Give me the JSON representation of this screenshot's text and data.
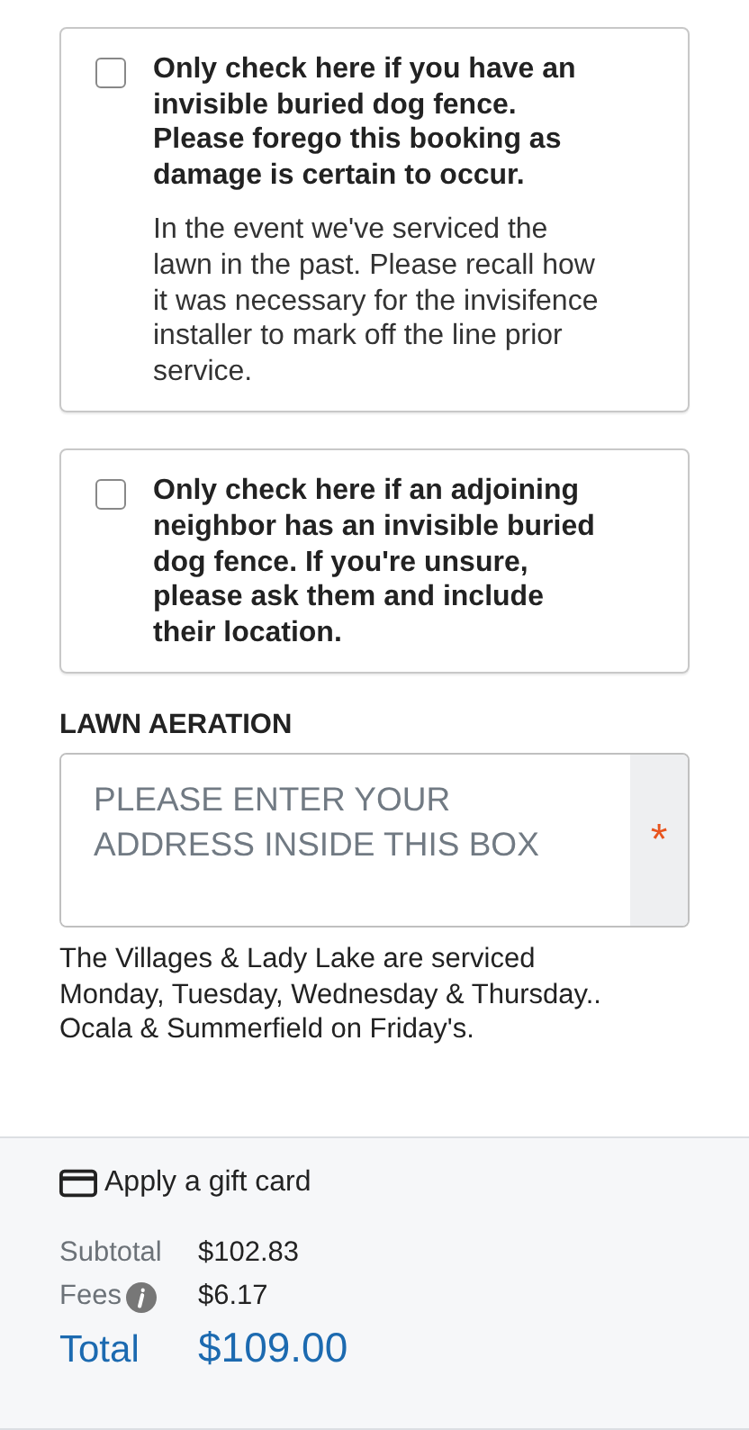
{
  "options": [
    {
      "checked": false,
      "label": "Only check here if you have an invisible buried dog fence. Please forego this booking as damage is certain to occur.",
      "note": "In the event we've serviced the lawn in the past. Please recall how it was necessary for the invisifence installer to mark off the line prior service."
    },
    {
      "checked": false,
      "label": "Only check here if an adjoining neighbor has an invisible buried dog fence. If you're unsure, please ask them and include their location."
    }
  ],
  "address": {
    "label": "LAWN AERATION",
    "placeholder": "PLEASE ENTER YOUR ADDRESS INSIDE THIS BOX",
    "required": true,
    "required_mark": "*"
  },
  "service_note": "The Villages & Lady Lake are serviced Monday, Tuesday, Wednesday & Thursday.. Ocala & Summerfield on Friday's.",
  "summary": {
    "gift_card": "Apply a gift card",
    "rows": [
      {
        "kind": "line",
        "label": "Subtotal",
        "value": "$102.83",
        "info": false
      },
      {
        "kind": "line",
        "label": "Fees",
        "value": "$6.17",
        "info": true
      },
      {
        "kind": "total",
        "label": "Total",
        "value": "$109.00",
        "info": false
      }
    ]
  }
}
